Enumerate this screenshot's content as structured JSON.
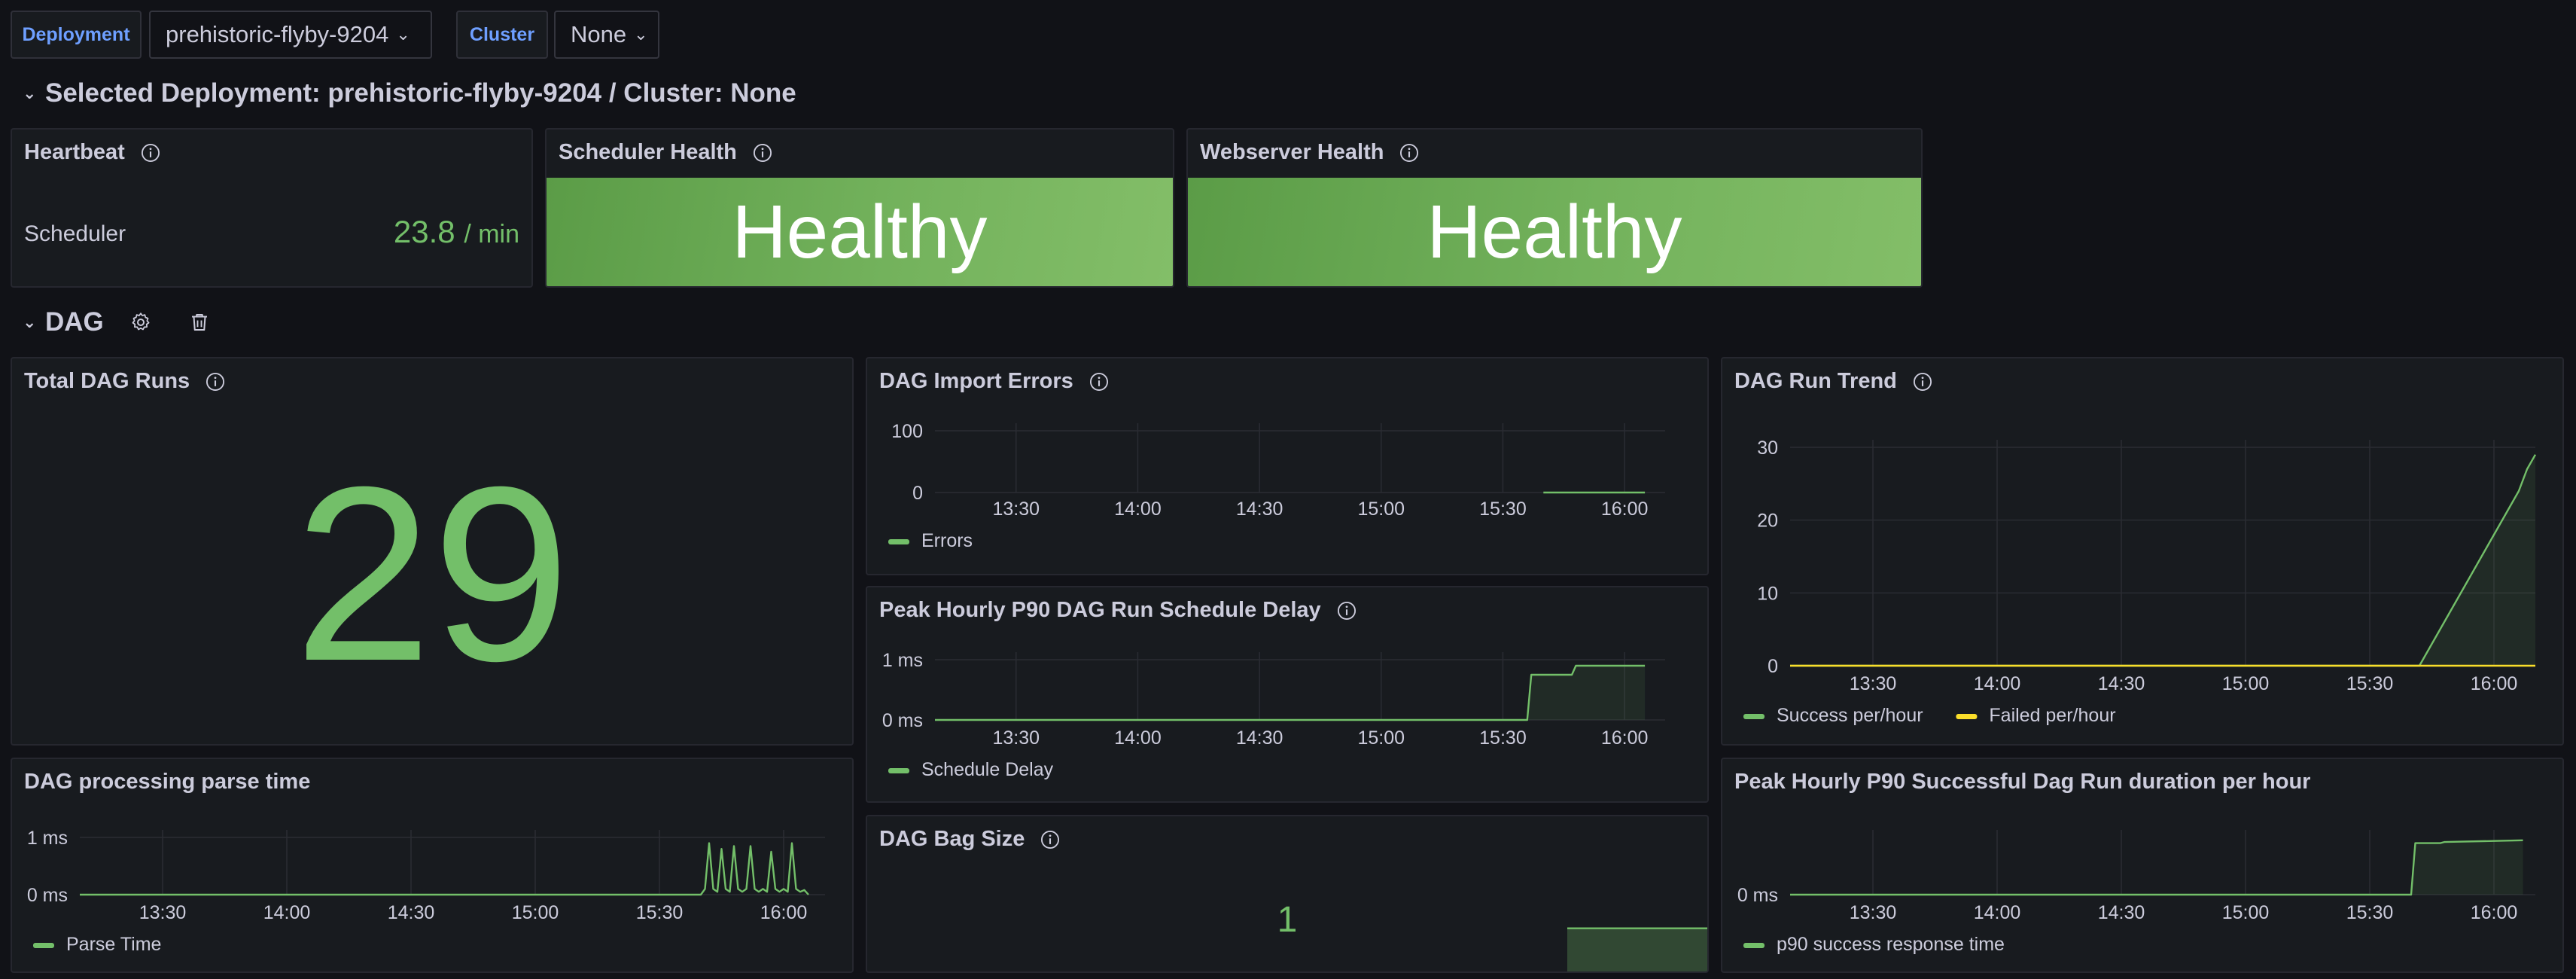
{
  "variables": {
    "deployment_label": "Deployment",
    "deployment_value": "prehistoric-flyby-9204",
    "cluster_label": "Cluster",
    "cluster_value": "None"
  },
  "rows": {
    "selected": "Selected Deployment: prehistoric-flyby-9204 / Cluster: None",
    "dag": "DAG"
  },
  "icons": {
    "row_settings": "gear-icon",
    "row_delete": "trash-icon",
    "panel_info": "info-icon"
  },
  "colors": {
    "accent_green": "#73bf69",
    "failed_yellow": "#fade2a",
    "health_green": "#73b25c",
    "label_blue": "#6e9fff"
  },
  "panels": {
    "heartbeat": {
      "title": "Heartbeat",
      "label": "Scheduler",
      "value": "23.8",
      "unit": "/ min"
    },
    "scheduler_health": {
      "title": "Scheduler Health",
      "value": "Healthy"
    },
    "webserver_health": {
      "title": "Webserver Health",
      "value": "Healthy"
    },
    "total_dag_runs": {
      "title": "Total DAG Runs",
      "value": "29"
    },
    "import_errors": {
      "title": "DAG Import Errors",
      "legend": "Errors"
    },
    "run_trend": {
      "title": "DAG Run Trend",
      "legend": [
        "Success per/hour",
        "Failed per/hour"
      ]
    },
    "schedule_delay": {
      "title": "Peak Hourly P90 DAG Run Schedule Delay",
      "legend": "Schedule Delay"
    },
    "parse_time": {
      "title": "DAG processing parse time",
      "legend": "Parse Time"
    },
    "bag_size": {
      "title": "DAG Bag Size",
      "value": "1"
    },
    "success_duration": {
      "title": "Peak Hourly P90 Successful Dag Run duration per hour",
      "legend": "p90 success response time"
    }
  },
  "chart_data": [
    {
      "id": "import_errors",
      "type": "line",
      "x": [
        "15:40",
        "16:05"
      ],
      "series": [
        {
          "name": "Errors",
          "values": [
            0,
            0
          ]
        }
      ],
      "x_ticks": [
        "13:30",
        "14:00",
        "14:30",
        "15:00",
        "15:30",
        "16:00"
      ],
      "y_ticks": [
        "100",
        "0"
      ],
      "xlim": [
        "13:10",
        "16:10"
      ],
      "ylim": [
        0,
        100
      ]
    },
    {
      "id": "run_trend",
      "type": "line",
      "x": [
        "13:10",
        "15:30",
        "15:42",
        "15:45",
        "15:48",
        "15:51",
        "15:54",
        "15:57",
        "16:00",
        "16:03",
        "16:06",
        "16:08",
        "16:10"
      ],
      "series": [
        {
          "name": "Success per/hour",
          "values": [
            0,
            0,
            0,
            3,
            6,
            9,
            12,
            15,
            18,
            21,
            24,
            27,
            29
          ]
        },
        {
          "name": "Failed per/hour",
          "values": [
            0,
            0,
            0,
            0,
            0,
            0,
            0,
            0,
            0,
            0,
            0,
            0,
            0
          ]
        }
      ],
      "x_ticks": [
        "13:30",
        "14:00",
        "14:30",
        "15:00",
        "15:30",
        "16:00"
      ],
      "y_ticks": [
        "30",
        "20",
        "10",
        "0"
      ],
      "xlim": [
        "13:10",
        "16:10"
      ],
      "ylim": [
        0,
        30
      ]
    },
    {
      "id": "schedule_delay",
      "type": "area",
      "x": [
        "13:10",
        "15:36",
        "15:37",
        "15:47",
        "15:48",
        "16:05"
      ],
      "series": [
        {
          "name": "Schedule Delay",
          "values": [
            0,
            0,
            0.75,
            0.75,
            0.9,
            0.9
          ]
        }
      ],
      "x_ticks": [
        "13:30",
        "14:00",
        "14:30",
        "15:00",
        "15:30",
        "16:00"
      ],
      "y_ticks": [
        "1 ms",
        "0 ms"
      ],
      "xlim": [
        "13:10",
        "16:10"
      ],
      "ylim": [
        0,
        1
      ]
    },
    {
      "id": "parse_time",
      "type": "line",
      "x": [
        "13:10",
        "15:40",
        "15:41",
        "15:42",
        "15:43",
        "15:44",
        "15:45",
        "15:46",
        "15:47",
        "15:48",
        "15:49",
        "15:50",
        "15:51",
        "15:52",
        "15:53",
        "15:54",
        "15:55",
        "15:56",
        "15:57",
        "15:58",
        "15:59",
        "16:00",
        "16:01",
        "16:02",
        "16:03",
        "16:04",
        "16:05",
        "16:06"
      ],
      "series": [
        {
          "name": "Parse Time",
          "values": [
            0,
            0,
            0.1,
            0.9,
            0.1,
            0.05,
            0.8,
            0.1,
            0.05,
            0.85,
            0.1,
            0.05,
            0.1,
            0.85,
            0.1,
            0.05,
            0.1,
            0.05,
            0.75,
            0.1,
            0.05,
            0.1,
            0.05,
            0.9,
            0.1,
            0.05,
            0.08,
            0
          ]
        }
      ],
      "x_ticks": [
        "13:30",
        "14:00",
        "14:30",
        "15:00",
        "15:30",
        "16:00"
      ],
      "y_ticks": [
        "1 ms",
        "0 ms"
      ],
      "xlim": [
        "13:10",
        "16:10"
      ],
      "ylim": [
        0,
        1
      ]
    },
    {
      "id": "success_duration",
      "type": "area",
      "x": [
        "13:10",
        "15:40",
        "15:41",
        "15:47",
        "15:48",
        "16:07"
      ],
      "series": [
        {
          "name": "p90 success response time",
          "values": [
            0,
            0,
            0.9,
            0.9,
            0.92,
            0.95
          ]
        }
      ],
      "x_ticks": [
        "13:30",
        "14:00",
        "14:30",
        "15:00",
        "15:30",
        "16:00"
      ],
      "y_ticks": [
        "0 ms"
      ],
      "xlim": [
        "13:10",
        "16:10"
      ],
      "ylim": [
        0,
        1
      ]
    },
    {
      "id": "bag_size",
      "type": "area",
      "x": [
        "15:40",
        "16:10"
      ],
      "series": [
        {
          "name": "DAG Bag Size",
          "values": [
            1,
            1
          ]
        }
      ],
      "xlim": [
        "13:10",
        "16:10"
      ],
      "ylim": [
        0,
        1.5
      ]
    }
  ]
}
